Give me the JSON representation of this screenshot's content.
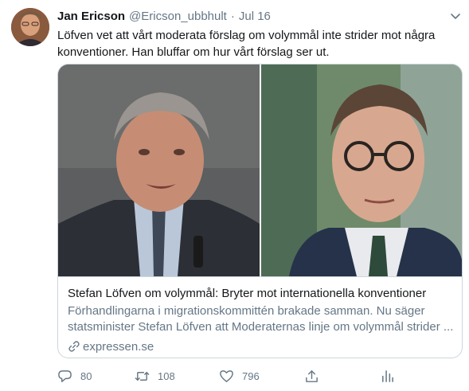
{
  "tweet": {
    "author": {
      "name": "Jan Ericson",
      "handle": "@Ericson_ubbhult",
      "separator": "·",
      "time": "Jul 16",
      "avatar_icon": "profile-photo"
    },
    "text": "Löfven vet att vårt moderata förslag om volymmål inte strider mot några konventioner. Han bluffar om hur vårt förslag ser ut.",
    "card": {
      "title": "Stefan Löfven om volymmål: Bryter mot internationella konventioner",
      "description": "Förhandlingarna i migrationskommittén brakade samman. Nu säger statsminister Stefan Löfven att Moderaternas linje om volymmål strider ...",
      "domain": "expressen.se",
      "link_icon": "link-icon"
    },
    "actions": {
      "reply_count": "80",
      "retweet_count": "108",
      "like_count": "796",
      "reply_icon": "comment-icon",
      "retweet_icon": "retweet-icon",
      "like_icon": "heart-icon",
      "share_icon": "share-icon",
      "analytics_icon": "analytics-icon"
    },
    "colors": {
      "text_primary": "#14171a",
      "text_secondary": "#657786",
      "border": "#ccd6dd"
    }
  }
}
